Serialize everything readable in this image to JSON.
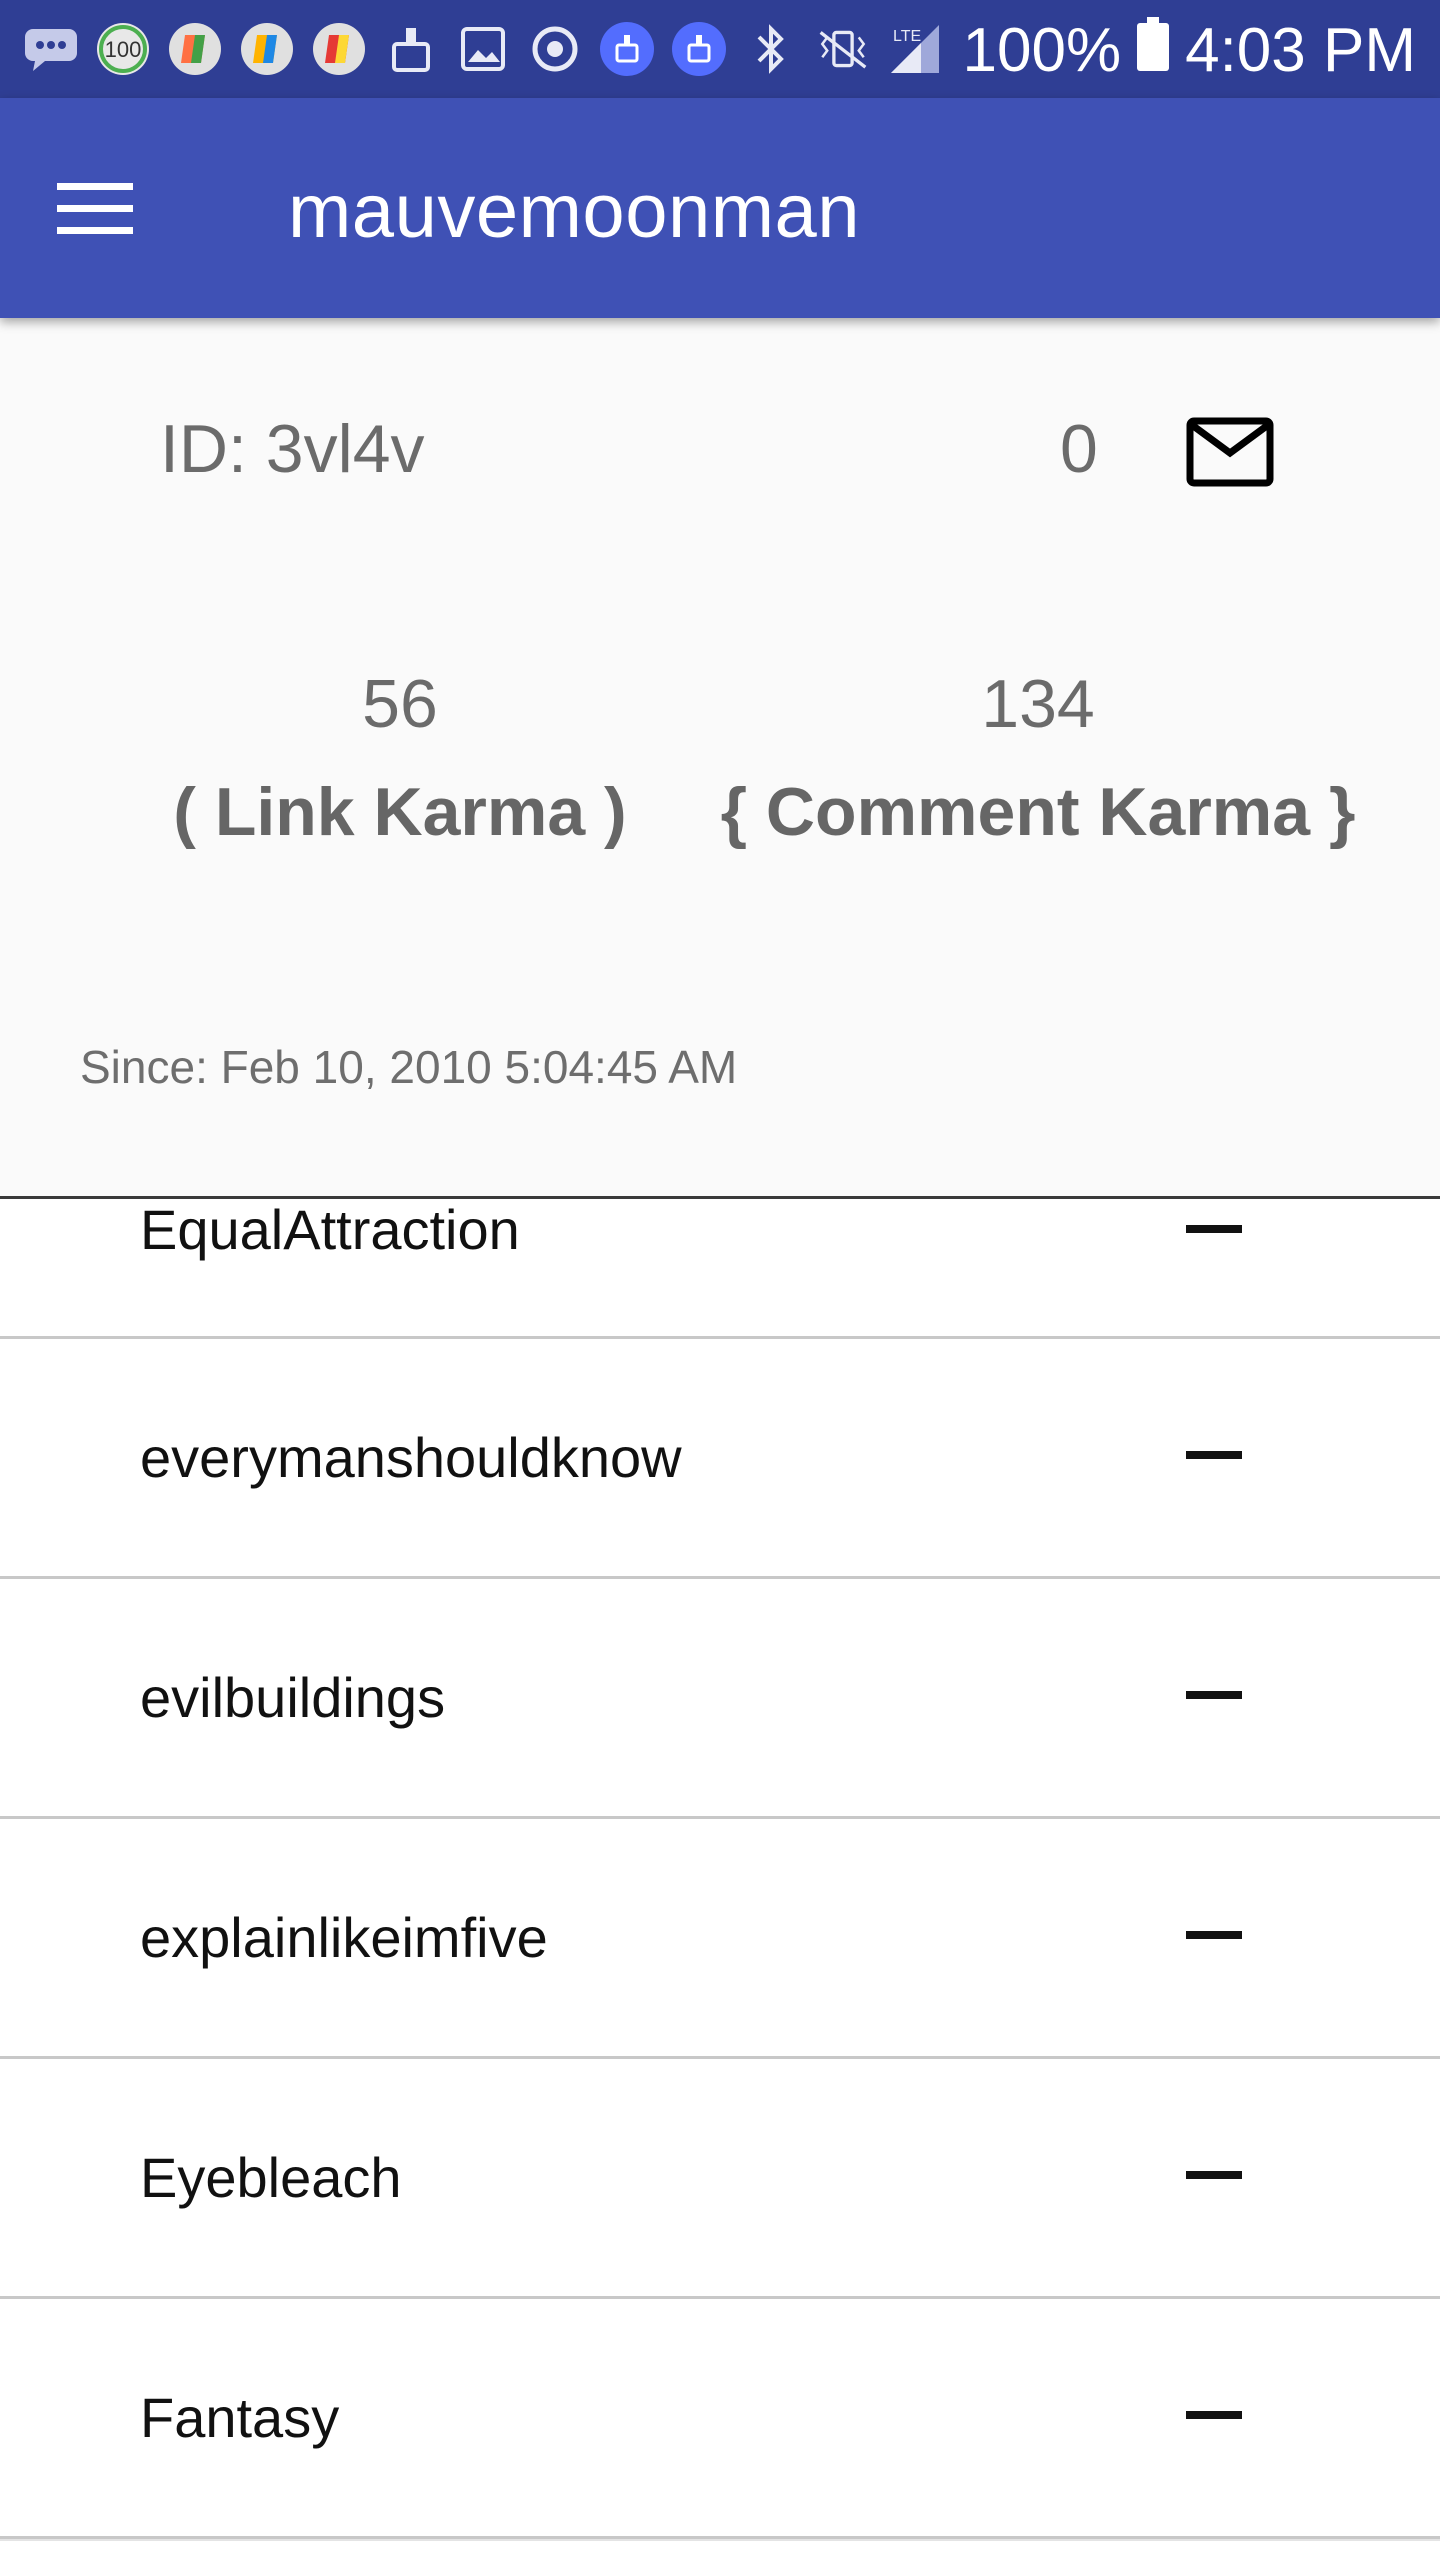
{
  "status_bar": {
    "battery": "100%",
    "time": "4:03 PM",
    "network": "LTE",
    "icons": [
      "chat-icon",
      "badge-100-icon",
      "app-icon",
      "app-icon",
      "app-icon",
      "cleaner-icon",
      "gallery-icon",
      "sync-icon",
      "cleaner-icon",
      "cleaner-icon",
      "bluetooth-icon",
      "vibrate-icon",
      "signal-icon",
      "battery-icon"
    ]
  },
  "app_bar": {
    "title": "mauvemoonman",
    "menu_icon": "hamburger-icon",
    "color": "#3f51b5"
  },
  "profile": {
    "id": "ID: 3vl4v",
    "message_count": "0",
    "mail_icon": "mail-icon",
    "link_karma": "56",
    "link_karma_label": "( Link Karma )",
    "comment_karma": "134",
    "comment_karma_label": "{ Comment Karma }",
    "since": "Since: Feb 10, 2010 5:04:45 AM"
  },
  "subreddits": [
    {
      "name": "EqualAttraction",
      "action_icon": "minus-icon"
    },
    {
      "name": "everymanshouldknow",
      "action_icon": "minus-icon"
    },
    {
      "name": "evilbuildings",
      "action_icon": "minus-icon"
    },
    {
      "name": "explainlikeimfive",
      "action_icon": "minus-icon"
    },
    {
      "name": "Eyebleach",
      "action_icon": "minus-icon"
    },
    {
      "name": "Fantasy",
      "action_icon": "minus-icon"
    }
  ]
}
